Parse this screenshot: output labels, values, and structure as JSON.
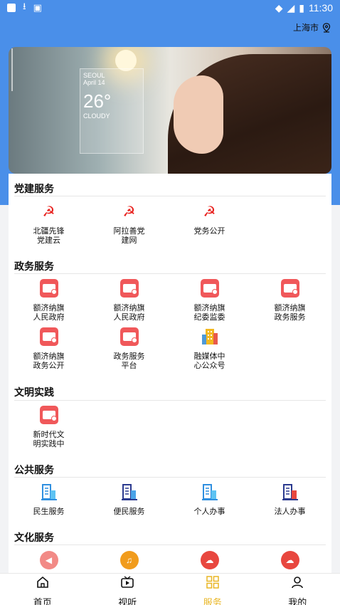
{
  "status_bar": {
    "time": "11:30"
  },
  "header": {
    "city": "上海市",
    "location_icon": "location-pin-icon"
  },
  "banner": {
    "city_label": "SEOUL",
    "date": "April 14",
    "temperature": "26°",
    "condition": "CLOUDY"
  },
  "sections": [
    {
      "title": "党建服务",
      "items": [
        {
          "label": "北疆先锋\n党建云",
          "icon": "party-emblem-icon"
        },
        {
          "label": "阿拉善党\n建网",
          "icon": "party-emblem-icon"
        },
        {
          "label": "党务公开",
          "icon": "party-emblem-icon"
        }
      ]
    },
    {
      "title": "政务服务",
      "items": [
        {
          "label": "额济纳旗\n人民政府",
          "icon": "government-doc-icon"
        },
        {
          "label": "额济纳旗\n人民政府",
          "icon": "government-doc-icon"
        },
        {
          "label": "额济纳旗\n纪委监委",
          "icon": "government-doc-icon"
        },
        {
          "label": "额济纳旗\n政务服务",
          "icon": "government-doc-icon"
        },
        {
          "label": "额济纳旗\n政务公开",
          "icon": "government-doc-icon"
        },
        {
          "label": "政务服务\n平台",
          "icon": "government-doc-icon"
        },
        {
          "label": "融媒体中\n心公众号",
          "icon": "building-icon"
        }
      ]
    },
    {
      "title": "文明实践",
      "items": [
        {
          "label": "新时代文\n明实践中",
          "icon": "government-doc-icon"
        }
      ]
    },
    {
      "title": "公共服务",
      "items": [
        {
          "label": "民生服务",
          "icon": "office-building-icon"
        },
        {
          "label": "便民服务",
          "icon": "office-building-icon"
        },
        {
          "label": "个人办事",
          "icon": "office-building-icon"
        },
        {
          "label": "法人办事",
          "icon": "office-building-icon"
        }
      ]
    },
    {
      "title": "文化服务",
      "items": [
        {
          "label": "",
          "icon": "speaker-icon"
        },
        {
          "label": "",
          "icon": "bell-icon"
        },
        {
          "label": "",
          "icon": "weather-icon"
        },
        {
          "label": "",
          "icon": "weather-icon"
        }
      ]
    }
  ],
  "bottom_nav": [
    {
      "label": "首页",
      "icon": "home-icon"
    },
    {
      "label": "视听",
      "icon": "video-icon"
    },
    {
      "label": "服务",
      "icon": "grid-icon",
      "active": true
    },
    {
      "label": "我的",
      "icon": "user-icon"
    }
  ],
  "colors": {
    "header_blue": "#4a8fe9",
    "active_nav": "#e9b624",
    "icon_red": "#f0585a"
  }
}
